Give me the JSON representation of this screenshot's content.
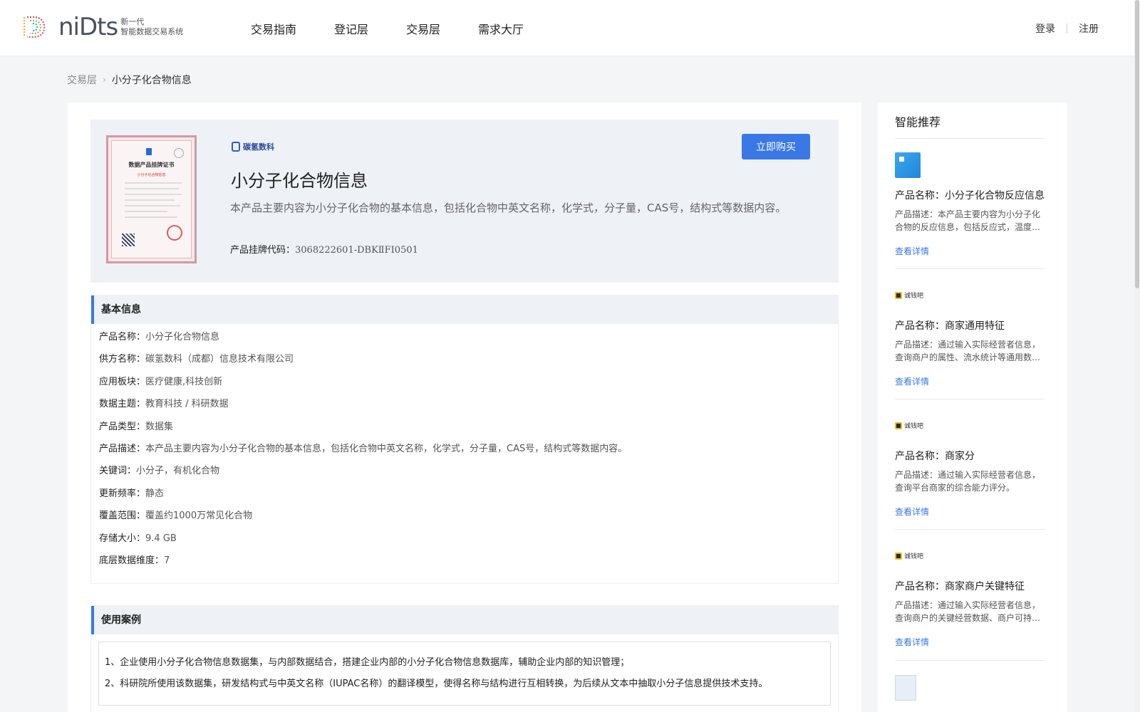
{
  "header": {
    "logo_word": "niDts",
    "logo_sub_1": "新一代",
    "logo_sub_2": "智能数据交易系统",
    "nav": [
      "交易指南",
      "登记层",
      "交易层",
      "需求大厅"
    ],
    "login": "登录",
    "register": "注册"
  },
  "breadcrumb": {
    "parent": "交易层",
    "sep": "›",
    "current": "小分子化合物信息"
  },
  "product": {
    "cert_title": "数据产品挂牌证书",
    "cert_sub": "小分子化合物信息",
    "vendor_logo_text": "碳氢数科",
    "title": "小分子化合物信息",
    "description": "本产品主要内容为小分子化合物的基本信息，包括化合物中英文名称，化学式，分子量，CAS号，结构式等数据内容。",
    "code_label": "产品挂牌代码：",
    "code_value": "3068222601-DBKⅡFI0501",
    "buy_label": "立即购买"
  },
  "basic_info": {
    "heading": "基本信息",
    "rows": [
      {
        "k": "产品名称：",
        "v": "小分子化合物信息"
      },
      {
        "k": "供方名称：",
        "v": "碳氢数科（成都）信息技术有限公司"
      },
      {
        "k": "应用板块：",
        "v": "医疗健康,科技创新"
      },
      {
        "k": "数据主题：",
        "v": "教育科技 / 科研数据"
      },
      {
        "k": "产品类型：",
        "v": "数据集"
      },
      {
        "k": "产品描述：",
        "v": "本产品主要内容为小分子化合物的基本信息，包括化合物中英文名称，化学式，分子量，CAS号，结构式等数据内容。"
      },
      {
        "k": "关键词：",
        "v": "小分子，有机化合物"
      },
      {
        "k": "更新频率：",
        "v": "静态"
      },
      {
        "k": "覆盖范围：",
        "v": "覆盖约1000万常见化合物"
      },
      {
        "k": "存储大小：",
        "v": "9.4 GB"
      },
      {
        "k": "底层数据维度：",
        "v": "7"
      }
    ]
  },
  "use_cases": {
    "heading": "使用案例",
    "items": [
      "1、企业使用小分子化合物信息数据集，与内部数据结合，搭建企业内部的小分子化合物信息数据库，辅助企业内部的知识管理；",
      "2、科研院所使用该数据集，研发结构式与中英文名称（IUPAC名称）的翻译模型，使得名称与结构进行互相转换，为后续从文本中抽取小分子信息提供技术支持。"
    ]
  },
  "sidebar": {
    "title": "智能推荐",
    "items": [
      {
        "logo": "",
        "name": "产品名称：小分子化合物反应信息",
        "desc": "产品描述：本产品主要内容为小分子化合物的反应信息，包括反应式，温度等数据内容。",
        "link": "查看详情"
      },
      {
        "logo": "诚钱吧",
        "name": "产品名称：商家通用特征",
        "desc": "产品描述：通过输入实际经营者信息，查询商户的属性、流水统计等通用数据。",
        "link": "查看详情"
      },
      {
        "logo": "诚钱吧",
        "name": "产品名称：商家分",
        "desc": "产品描述：通过输入实际经营者信息，查询平台商家的综合能力评分。",
        "link": "查看详情"
      },
      {
        "logo": "诚钱吧",
        "name": "产品名称：商家商户关键特征",
        "desc": "产品描述：通过输入实际经营者信息，查询商户的关键经营数据、商户可持续经营情况。",
        "link": "查看详情"
      }
    ]
  }
}
